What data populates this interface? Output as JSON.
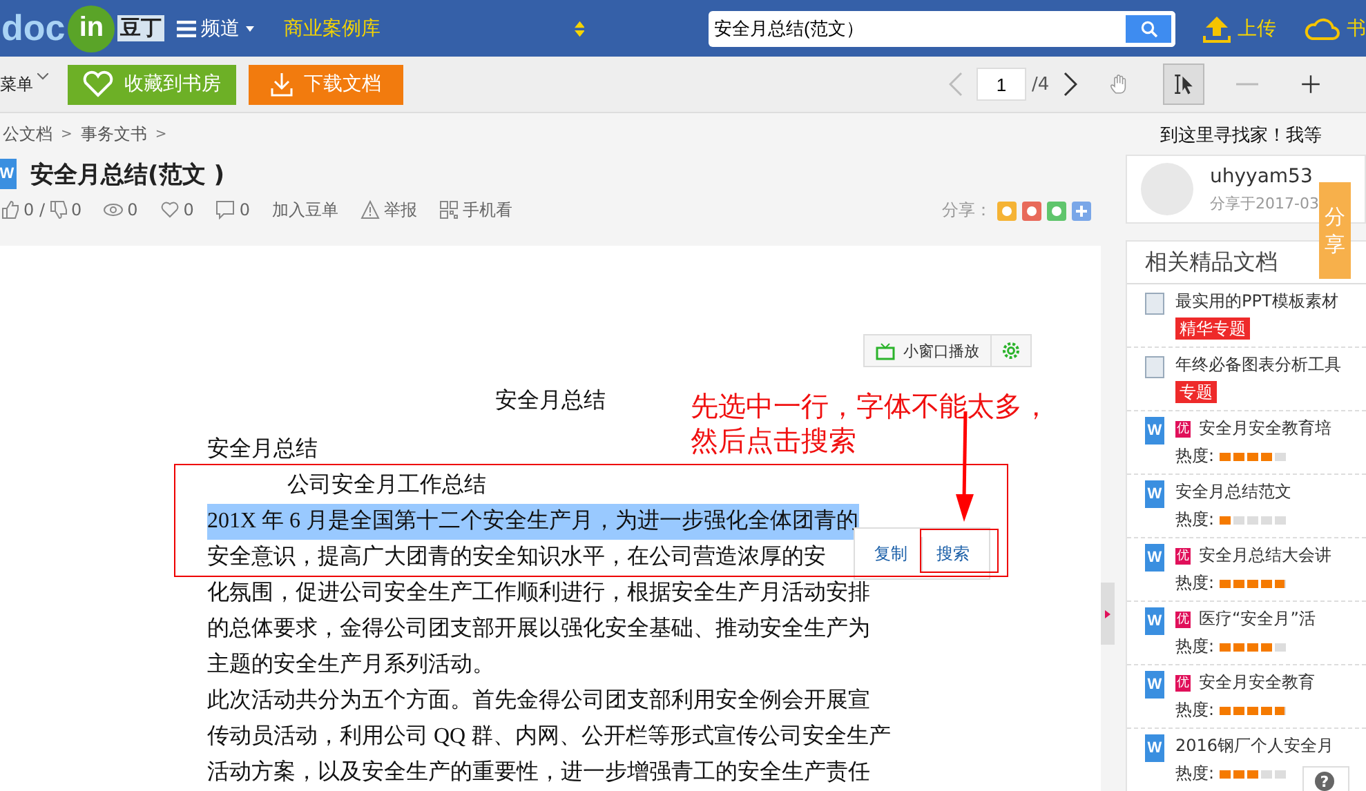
{
  "header": {
    "logo": {
      "part_1": "doc",
      "part_2": "in",
      "part_3": "豆丁"
    },
    "nav": [
      {
        "kind": "menu",
        "label": "频道"
      },
      {
        "kind": "highlight",
        "label": "商业案例库"
      }
    ],
    "search": {
      "value": "安全月总结(范文）"
    },
    "actions": [
      {
        "kind": "upload",
        "label": "上传"
      },
      {
        "kind": "cloud",
        "label": "书"
      }
    ]
  },
  "toolbar": {
    "menu": "菜单",
    "favorite_button": "收藏到书房",
    "download_button": "下载文档",
    "page": {
      "value": "1",
      "total": "/4"
    },
    "tools": [
      {
        "kind": "hand",
        "selected": false
      },
      {
        "kind": "select",
        "selected": true
      },
      {
        "kind": "minus",
        "selected": false
      },
      {
        "kind": "plus",
        "selected": false
      }
    ]
  },
  "breadcrumb": [
    {
      "label": "公文档",
      "separator": ">"
    },
    {
      "label": "事务文书",
      "separator": ">"
    }
  ],
  "document": {
    "title_icon": "W",
    "title": "安全月总结(范文 )",
    "stats": [
      {
        "kind": "like",
        "label": "0 / "
      },
      {
        "kind": "dislike",
        "label": "0"
      },
      {
        "kind": "view",
        "label": "0"
      },
      {
        "kind": "heart",
        "label": "0"
      },
      {
        "kind": "comment",
        "label": "0"
      },
      {
        "kind": "plain",
        "label": "加入豆单"
      },
      {
        "kind": "warn",
        "label": "举报"
      },
      {
        "kind": "qr",
        "label": "手机看"
      }
    ],
    "share_label": "分享：",
    "mini_player": "小窗口播放",
    "page": {
      "heading": "安全月总结",
      "lines": [
        {
          "text": "安全月总结",
          "indent": false,
          "selected": false
        },
        {
          "text": "公司安全月工作总结",
          "indent": true,
          "selected": false
        },
        {
          "text": "201X 年 6 月是全国第十二个安全生产月，为进一步强化全体团青的",
          "indent": false,
          "selected": true
        },
        {
          "text": "安全意识，提高广大团青的安全知识水平，在公司营造浓厚的安",
          "indent": false,
          "selected": false
        },
        {
          "text": "化氛围，促进公司安全生产工作顺利进行，根据安全生产月活动安排",
          "indent": false,
          "selected": false
        },
        {
          "text": "的总体要求，金得公司团支部开展以强化安全基础、推动安全生产为",
          "indent": false,
          "selected": false
        },
        {
          "text": "主题的安全生产月系列活动。",
          "indent": false,
          "selected": false
        },
        {
          "text": "此次活动共分为五个方面。首先金得公司团支部利用安全例会开展宣",
          "indent": false,
          "selected": false
        },
        {
          "text": "传动员活动，利用公司 QQ 群、内网、公开栏等形式宣传公司安全生产",
          "indent": false,
          "selected": false
        },
        {
          "text": "活动方案，以及安全生产的重要性，进一步增强青工的安全生产责任",
          "indent": false,
          "selected": false
        }
      ],
      "popup": [
        "复制",
        "搜索"
      ]
    },
    "annotation": [
      "先选中一行，字体不能太多，",
      "然后点击搜索"
    ]
  },
  "sidebar": {
    "promo": "到这里寻找家！我等",
    "user": {
      "name": "uhyyam53",
      "shared": "分享于2017-03"
    },
    "share_tab": "分享",
    "related_title": "相关精品文档",
    "items": [
      {
        "kind": "topic",
        "title": "最实用的PPT模板素材",
        "badge": "精华专题"
      },
      {
        "kind": "topic",
        "title": "年终必备图表分析工具",
        "badge": "专题"
      },
      {
        "kind": "doc",
        "icon": "W",
        "premium_mark": "优",
        "title": "安全月安全教育培",
        "heat_label": "热度:",
        "level": 0.8
      },
      {
        "kind": "doc",
        "icon": "W",
        "title": "安全月总结范文",
        "heat_label": "热度:",
        "level": 0.2
      },
      {
        "kind": "doc",
        "icon": "W",
        "premium_mark": "优",
        "title": "安全月总结大会讲",
        "heat_label": "热度:",
        "level": 1
      },
      {
        "kind": "doc",
        "icon": "W",
        "premium_mark": "优",
        "title": "医疗“安全月”活",
        "heat_label": "热度:",
        "level": 0.8
      },
      {
        "kind": "doc",
        "icon": "W",
        "premium_mark": "优",
        "title": "安全月安全教育",
        "heat_label": "热度:",
        "level": 1
      },
      {
        "kind": "doc",
        "icon": "W",
        "title": "2016钢厂个人安全月",
        "heat_label": "热度:",
        "level": 0.6
      }
    ],
    "help": "?"
  }
}
